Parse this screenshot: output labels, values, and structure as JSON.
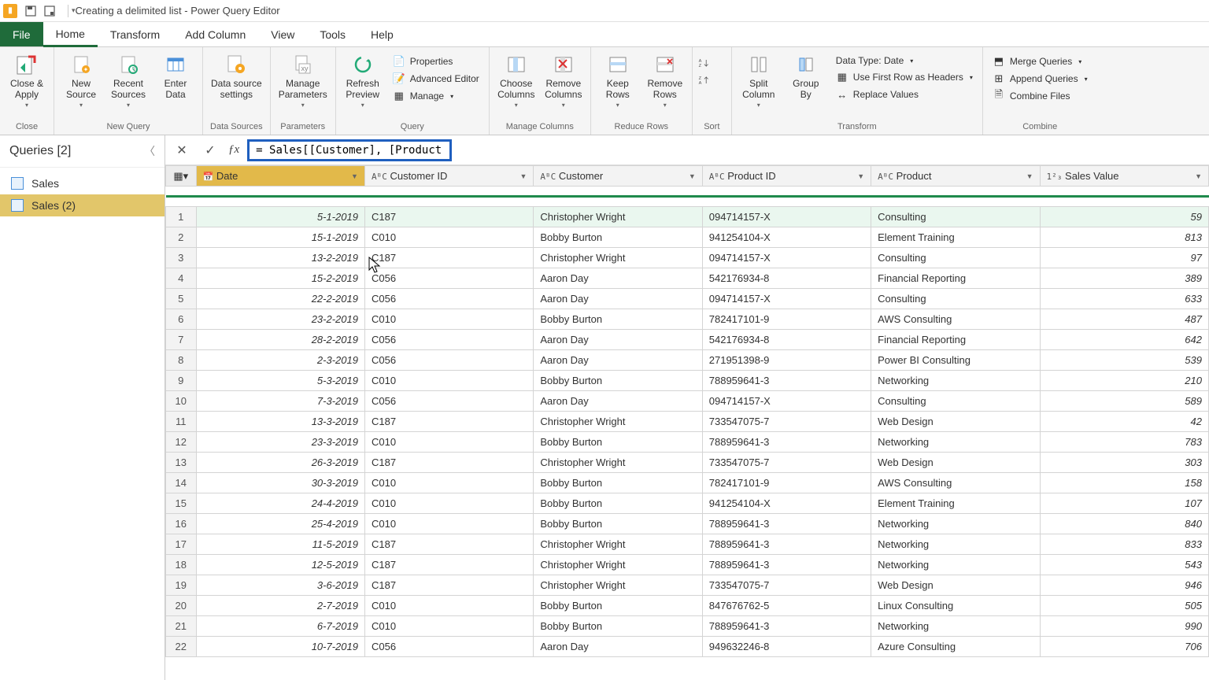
{
  "title": "Creating a delimited list - Power Query Editor",
  "menu": {
    "file": "File",
    "home": "Home",
    "transform": "Transform",
    "addcol": "Add Column",
    "view": "View",
    "tools": "Tools",
    "help": "Help"
  },
  "ribbon": {
    "close_apply": "Close &\nApply",
    "new_source": "New\nSource",
    "recent_sources": "Recent\nSources",
    "enter_data": "Enter\nData",
    "data_source": "Data source\nsettings",
    "manage_params": "Manage\nParameters",
    "refresh": "Refresh\nPreview",
    "properties": "Properties",
    "adv_editor": "Advanced Editor",
    "manage": "Manage",
    "choose_cols": "Choose\nColumns",
    "remove_cols": "Remove\nColumns",
    "keep_rows": "Keep\nRows",
    "remove_rows": "Remove\nRows",
    "sort_asc": "",
    "split_col": "Split\nColumn",
    "group_by": "Group\nBy",
    "data_type": "Data Type: Date",
    "first_row": "Use First Row as Headers",
    "replace": "Replace Values",
    "merge": "Merge Queries",
    "append": "Append Queries",
    "combine_files": "Combine Files",
    "g_close": "Close",
    "g_newq": "New Query",
    "g_ds": "Data Sources",
    "g_params": "Parameters",
    "g_query": "Query",
    "g_mc": "Manage Columns",
    "g_rr": "Reduce Rows",
    "g_sort": "Sort",
    "g_transform": "Transform",
    "g_combine": "Combine"
  },
  "queries": {
    "header": "Queries [2]",
    "items": [
      "Sales",
      "Sales (2)"
    ]
  },
  "formula": "= Sales[[Customer], [Product]]",
  "columns": [
    "Date",
    "Customer ID",
    "Customer",
    "Product ID",
    "Product",
    "Sales Value"
  ],
  "col_types": [
    "📅",
    "AᴮC",
    "AᴮC",
    "AᴮC",
    "AᴮC",
    "1²₃"
  ],
  "rows": [
    [
      "5-1-2019",
      "C187",
      "Christopher Wright",
      "094714157-X",
      "Consulting",
      "59"
    ],
    [
      "15-1-2019",
      "C010",
      "Bobby Burton",
      "941254104-X",
      "Element Training",
      "813"
    ],
    [
      "13-2-2019",
      "C187",
      "Christopher Wright",
      "094714157-X",
      "Consulting",
      "97"
    ],
    [
      "15-2-2019",
      "C056",
      "Aaron Day",
      "542176934-8",
      "Financial Reporting",
      "389"
    ],
    [
      "22-2-2019",
      "C056",
      "Aaron Day",
      "094714157-X",
      "Consulting",
      "633"
    ],
    [
      "23-2-2019",
      "C010",
      "Bobby Burton",
      "782417101-9",
      "AWS Consulting",
      "487"
    ],
    [
      "28-2-2019",
      "C056",
      "Aaron Day",
      "542176934-8",
      "Financial Reporting",
      "642"
    ],
    [
      "2-3-2019",
      "C056",
      "Aaron Day",
      "271951398-9",
      "Power BI Consulting",
      "539"
    ],
    [
      "5-3-2019",
      "C010",
      "Bobby Burton",
      "788959641-3",
      "Networking",
      "210"
    ],
    [
      "7-3-2019",
      "C056",
      "Aaron Day",
      "094714157-X",
      "Consulting",
      "589"
    ],
    [
      "13-3-2019",
      "C187",
      "Christopher Wright",
      "733547075-7",
      "Web Design",
      "42"
    ],
    [
      "23-3-2019",
      "C010",
      "Bobby Burton",
      "788959641-3",
      "Networking",
      "783"
    ],
    [
      "26-3-2019",
      "C187",
      "Christopher Wright",
      "733547075-7",
      "Web Design",
      "303"
    ],
    [
      "30-3-2019",
      "C010",
      "Bobby Burton",
      "782417101-9",
      "AWS Consulting",
      "158"
    ],
    [
      "24-4-2019",
      "C010",
      "Bobby Burton",
      "941254104-X",
      "Element Training",
      "107"
    ],
    [
      "25-4-2019",
      "C010",
      "Bobby Burton",
      "788959641-3",
      "Networking",
      "840"
    ],
    [
      "11-5-2019",
      "C187",
      "Christopher Wright",
      "788959641-3",
      "Networking",
      "833"
    ],
    [
      "12-5-2019",
      "C187",
      "Christopher Wright",
      "788959641-3",
      "Networking",
      "543"
    ],
    [
      "3-6-2019",
      "C187",
      "Christopher Wright",
      "733547075-7",
      "Web Design",
      "946"
    ],
    [
      "2-7-2019",
      "C010",
      "Bobby Burton",
      "847676762-5",
      "Linux Consulting",
      "505"
    ],
    [
      "6-7-2019",
      "C010",
      "Bobby Burton",
      "788959641-3",
      "Networking",
      "990"
    ],
    [
      "10-7-2019",
      "C056",
      "Aaron Day",
      "949632246-8",
      "Azure Consulting",
      "706"
    ]
  ]
}
